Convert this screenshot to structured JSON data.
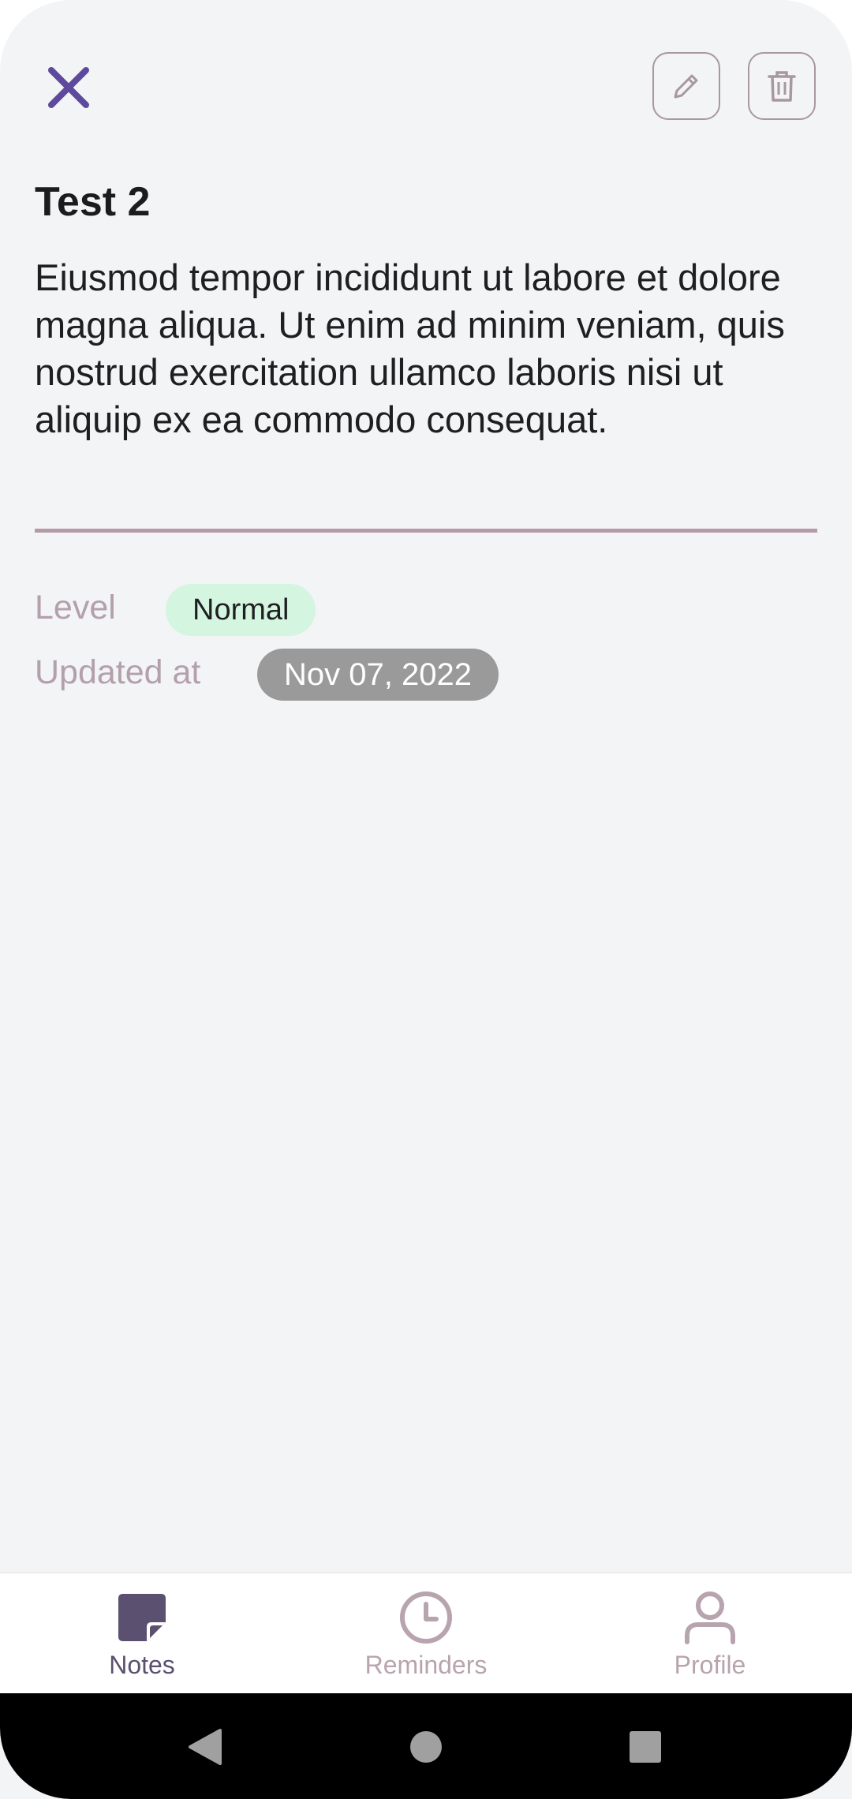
{
  "note": {
    "title": "Test 2",
    "body": "Eiusmod tempor incididunt ut labore et dolore magna aliqua. Ut enim ad minim veniam, quis nostrud exercitation ullamco laboris nisi ut aliquip ex ea commodo consequat."
  },
  "meta": {
    "level_label": "Level",
    "level_value": "Normal",
    "updated_label": "Updated at",
    "updated_value": "Nov 07, 2022"
  },
  "toolbar": {
    "close_icon": "close-icon",
    "edit_icon": "pencil-icon",
    "delete_icon": "trash-icon"
  },
  "bottom_nav": {
    "items": [
      {
        "label": "Notes",
        "icon": "note-icon",
        "active": true
      },
      {
        "label": "Reminders",
        "icon": "clock-icon",
        "active": false
      },
      {
        "label": "Profile",
        "icon": "person-icon",
        "active": false
      }
    ]
  },
  "colors": {
    "accent": "#5e4a9c",
    "level_badge_bg": "#d4f5df",
    "date_badge_bg": "#9a9a9a",
    "divider": "#b39aa6"
  }
}
